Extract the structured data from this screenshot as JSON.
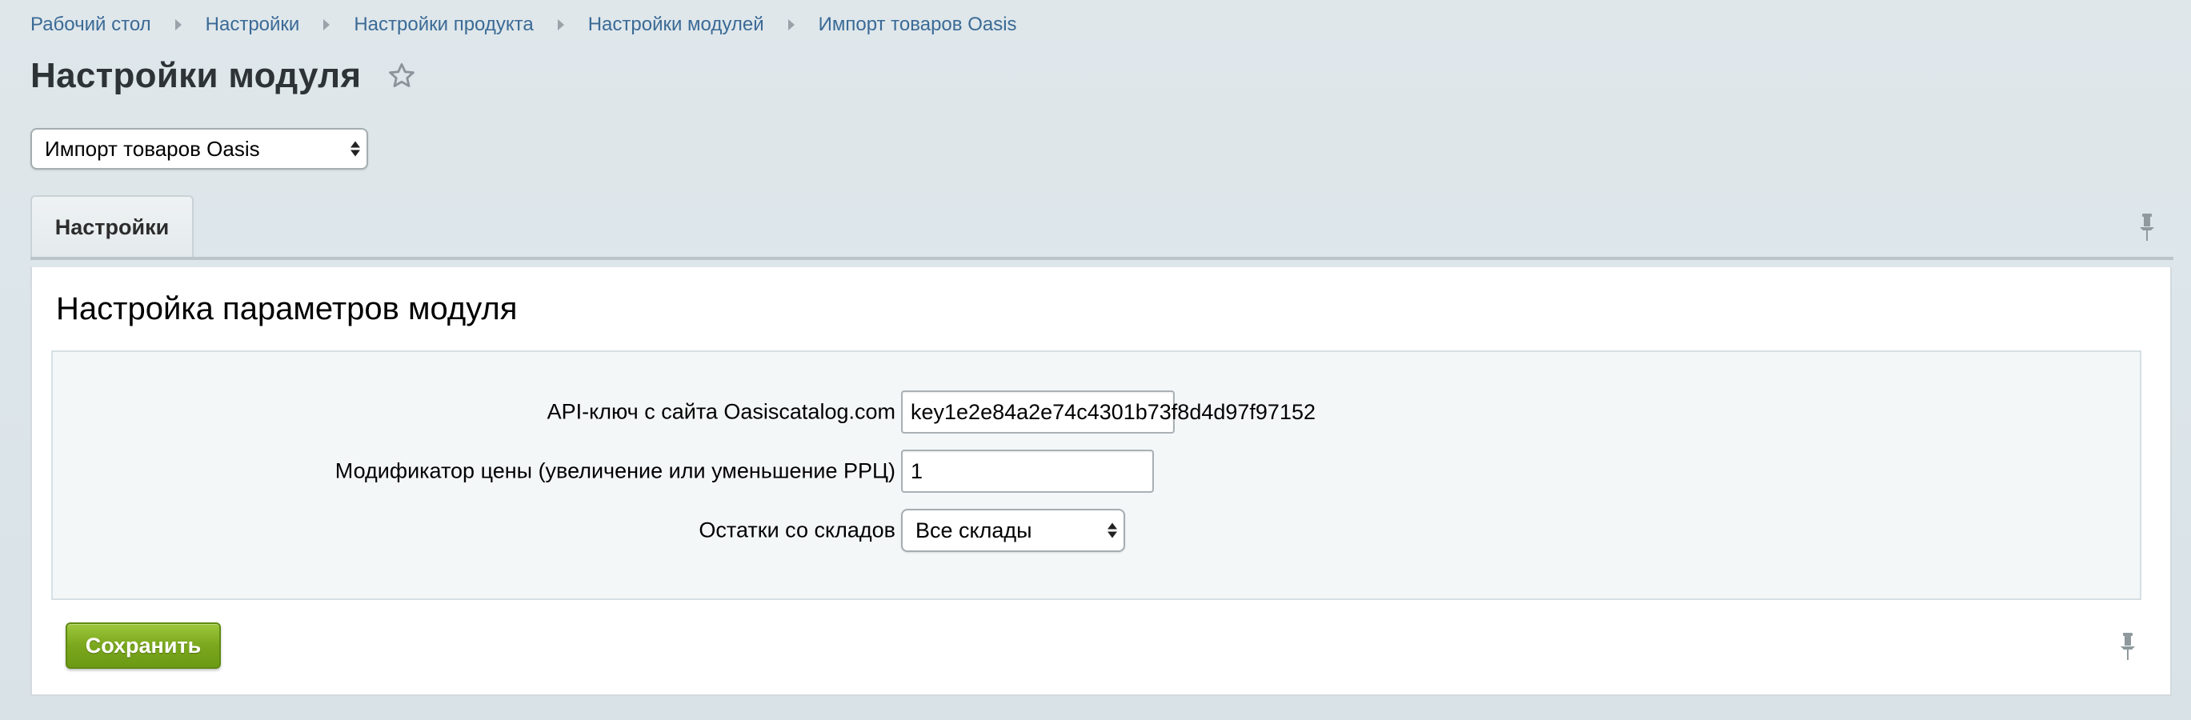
{
  "breadcrumbs": [
    {
      "label": "Рабочий стол"
    },
    {
      "label": "Настройки"
    },
    {
      "label": "Настройки продукта"
    },
    {
      "label": "Настройки модулей"
    },
    {
      "label": "Импорт товаров Oasis"
    }
  ],
  "header": {
    "title": "Настройки модуля",
    "favorite_icon": "star-icon"
  },
  "module_select": {
    "value": "Импорт товаров Oasis"
  },
  "tabs": [
    {
      "label": "Настройки",
      "active": true
    }
  ],
  "panel": {
    "title": "Настройка параметров модуля",
    "fields": {
      "api_key": {
        "label": "API-ключ с сайта Oasiscatalog.com :",
        "value": "key1e2e84a2e74c4301b73f8d4d97f97152"
      },
      "price_modifier": {
        "label": "Модификатор цены (увеличение или уменьшение РРЦ) :",
        "value": "1"
      },
      "stock": {
        "label": "Остатки со складов :",
        "value": "Все склады"
      }
    },
    "save_label": "Сохранить"
  },
  "icons": {
    "pin": "pin-icon",
    "breadcrumb_separator": "triangle-right-icon"
  },
  "colors": {
    "link": "#3b6a95",
    "save_button": "#7aa71d",
    "background": "#dde6ea"
  }
}
